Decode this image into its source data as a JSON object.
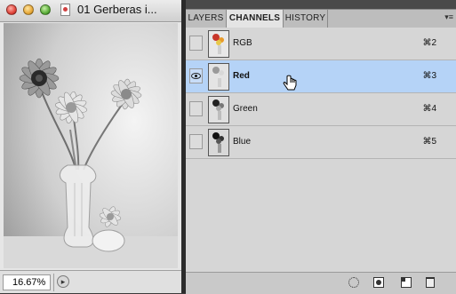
{
  "document": {
    "title": "01 Gerberas i...",
    "zoom": "16.67%"
  },
  "panel": {
    "tabs": [
      {
        "label": "LAYERS"
      },
      {
        "label": "CHANNELS"
      },
      {
        "label": "HISTORY"
      }
    ],
    "active_tab": "CHANNELS",
    "menu_icon": "panel-menu-icon",
    "channels": [
      {
        "name": "RGB",
        "shortcut": "⌘2",
        "visible": false,
        "selected": false
      },
      {
        "name": "Red",
        "shortcut": "⌘3",
        "visible": true,
        "selected": true
      },
      {
        "name": "Green",
        "shortcut": "⌘4",
        "visible": false,
        "selected": false
      },
      {
        "name": "Blue",
        "shortcut": "⌘5",
        "visible": false,
        "selected": false
      }
    ],
    "footer_icons": [
      "load-selection-icon",
      "save-selection-icon",
      "new-channel-icon",
      "delete-channel-icon"
    ]
  },
  "colors": {
    "selection": "#b5d3f7",
    "panel_bg": "#d6d6d6"
  }
}
